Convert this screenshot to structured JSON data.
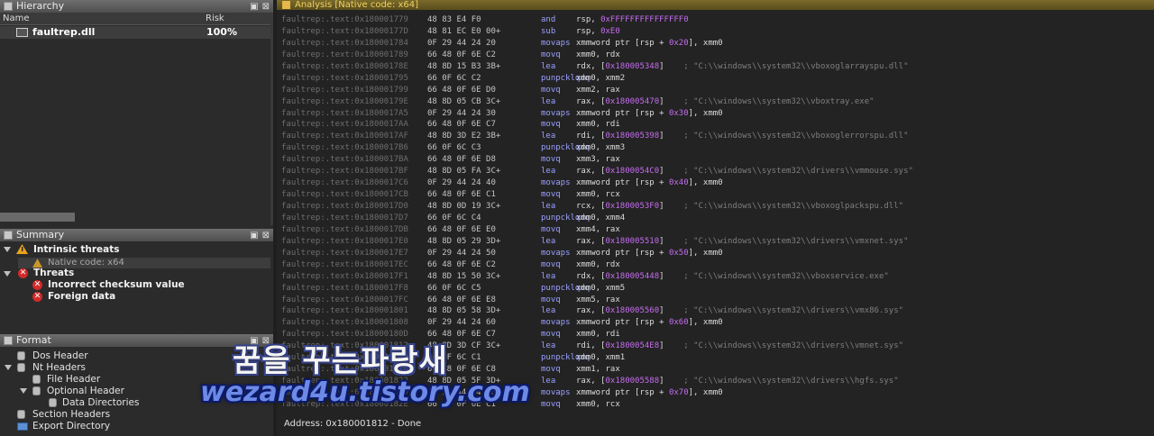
{
  "hierarchy": {
    "title": "Hierarchy",
    "col_name": "Name",
    "col_risk": "Risk",
    "row": {
      "name": "faultrep.dll",
      "risk": "100%"
    }
  },
  "summary": {
    "title": "Summary",
    "intrinsic": "Intrinsic threats",
    "native": "Native code: x64",
    "threats": "Threats",
    "items": [
      "Incorrect checksum value",
      "Foreign data"
    ]
  },
  "format": {
    "title": "Format",
    "items": [
      {
        "label": "Dos Header",
        "icon": "database-icon"
      },
      {
        "label": "Nt Headers",
        "icon": "database-icon"
      },
      {
        "label": "File Header",
        "icon": "database-icon"
      },
      {
        "label": "Optional Header",
        "icon": "database-icon"
      },
      {
        "label": "Data Directories",
        "icon": "database-icon"
      },
      {
        "label": "Section Headers",
        "icon": "database-icon"
      },
      {
        "label": "Export Directory",
        "icon": "folder-icon"
      }
    ]
  },
  "analysis": {
    "title": "Analysis [Native code: x64]",
    "status": "Address: 0x180001812 - Done",
    "lines": [
      {
        "addr": "faultrep:.text:0x180001779",
        "bytes": "48 83 E4 F0",
        "mn": "and",
        "op": "rsp, ",
        "imm": "0xFFFFFFFFFFFFFFF0",
        "op2": "",
        "cm": ""
      },
      {
        "addr": "faultrep:.text:0x18000177D",
        "bytes": "48 81 EC E0 00+",
        "mn": "sub",
        "op": "rsp, ",
        "imm": "0xE0",
        "op2": "",
        "cm": ""
      },
      {
        "addr": "faultrep:.text:0x180001784",
        "bytes": "0F 29 44 24 20",
        "mn": "movaps",
        "op": "xmmword ptr [rsp + ",
        "imm": "0x20",
        "op2": "], xmm0",
        "cm": ""
      },
      {
        "addr": "faultrep:.text:0x180001789",
        "bytes": "66 48 0F 6E C2",
        "mn": "movq",
        "op": "xmm0, rdx",
        "imm": "",
        "op2": "",
        "cm": ""
      },
      {
        "addr": "faultrep:.text:0x18000178E",
        "bytes": "48 8D 15 B3 3B+",
        "mn": "lea",
        "op": "rdx, [",
        "imm": "0x180005348",
        "op2": "]",
        "cm": "; \"C:\\\\windows\\\\system32\\\\vboxoglarrayspu.dll\""
      },
      {
        "addr": "faultrep:.text:0x180001795",
        "bytes": "66 0F 6C C2",
        "mn": "punpcklqdq",
        "op": "xmm0, xmm2",
        "imm": "",
        "op2": "",
        "cm": ""
      },
      {
        "addr": "faultrep:.text:0x180001799",
        "bytes": "66 48 0F 6E D0",
        "mn": "movq",
        "op": "xmm2, rax",
        "imm": "",
        "op2": "",
        "cm": ""
      },
      {
        "addr": "faultrep:.text:0x18000179E",
        "bytes": "48 8D 05 CB 3C+",
        "mn": "lea",
        "op": "rax, [",
        "imm": "0x180005470",
        "op2": "]",
        "cm": "; \"C:\\\\windows\\\\system32\\\\vboxtray.exe\""
      },
      {
        "addr": "faultrep:.text:0x1800017A5",
        "bytes": "0F 29 44 24 30",
        "mn": "movaps",
        "op": "xmmword ptr [rsp + ",
        "imm": "0x30",
        "op2": "], xmm0",
        "cm": ""
      },
      {
        "addr": "faultrep:.text:0x1800017AA",
        "bytes": "66 48 0F 6E C7",
        "mn": "movq",
        "op": "xmm0, rdi",
        "imm": "",
        "op2": "",
        "cm": ""
      },
      {
        "addr": "faultrep:.text:0x1800017AF",
        "bytes": "48 8D 3D E2 3B+",
        "mn": "lea",
        "op": "rdi, [",
        "imm": "0x180005398",
        "op2": "]",
        "cm": "; \"C:\\\\windows\\\\system32\\\\vboxoglerrorspu.dll\""
      },
      {
        "addr": "faultrep:.text:0x1800017B6",
        "bytes": "66 0F 6C C3",
        "mn": "punpcklqdq",
        "op": "xmm0, xmm3",
        "imm": "",
        "op2": "",
        "cm": ""
      },
      {
        "addr": "faultrep:.text:0x1800017BA",
        "bytes": "66 48 0F 6E D8",
        "mn": "movq",
        "op": "xmm3, rax",
        "imm": "",
        "op2": "",
        "cm": ""
      },
      {
        "addr": "faultrep:.text:0x1800017BF",
        "bytes": "48 8D 05 FA 3C+",
        "mn": "lea",
        "op": "rax, [",
        "imm": "0x1800054C0",
        "op2": "]",
        "cm": "; \"C:\\\\windows\\\\system32\\\\drivers\\\\vmmouse.sys\""
      },
      {
        "addr": "faultrep:.text:0x1800017C6",
        "bytes": "0F 29 44 24 40",
        "mn": "movaps",
        "op": "xmmword ptr [rsp + ",
        "imm": "0x40",
        "op2": "], xmm0",
        "cm": ""
      },
      {
        "addr": "faultrep:.text:0x1800017CB",
        "bytes": "66 48 0F 6E C1",
        "mn": "movq",
        "op": "xmm0, rcx",
        "imm": "",
        "op2": "",
        "cm": ""
      },
      {
        "addr": "faultrep:.text:0x1800017D0",
        "bytes": "48 8D 0D 19 3C+",
        "mn": "lea",
        "op": "rcx, [",
        "imm": "0x1800053F0",
        "op2": "]",
        "cm": "; \"C:\\\\windows\\\\system32\\\\vboxoglpackspu.dll\""
      },
      {
        "addr": "faultrep:.text:0x1800017D7",
        "bytes": "66 0F 6C C4",
        "mn": "punpcklqdq",
        "op": "xmm0, xmm4",
        "imm": "",
        "op2": "",
        "cm": ""
      },
      {
        "addr": "faultrep:.text:0x1800017DB",
        "bytes": "66 48 0F 6E E0",
        "mn": "movq",
        "op": "xmm4, rax",
        "imm": "",
        "op2": "",
        "cm": ""
      },
      {
        "addr": "faultrep:.text:0x1800017E0",
        "bytes": "48 8D 05 29 3D+",
        "mn": "lea",
        "op": "rax, [",
        "imm": "0x180005510",
        "op2": "]",
        "cm": "; \"C:\\\\windows\\\\system32\\\\drivers\\\\vmxnet.sys\""
      },
      {
        "addr": "faultrep:.text:0x1800017E7",
        "bytes": "0F 29 44 24 50",
        "mn": "movaps",
        "op": "xmmword ptr [rsp + ",
        "imm": "0x50",
        "op2": "], xmm0",
        "cm": ""
      },
      {
        "addr": "faultrep:.text:0x1800017EC",
        "bytes": "66 48 0F 6E C2",
        "mn": "movq",
        "op": "xmm0, rdx",
        "imm": "",
        "op2": "",
        "cm": ""
      },
      {
        "addr": "faultrep:.text:0x1800017F1",
        "bytes": "48 8D 15 50 3C+",
        "mn": "lea",
        "op": "rdx, [",
        "imm": "0x180005448",
        "op2": "]",
        "cm": "; \"C:\\\\windows\\\\system32\\\\vboxservice.exe\""
      },
      {
        "addr": "faultrep:.text:0x1800017F8",
        "bytes": "66 0F 6C C5",
        "mn": "punpcklqdq",
        "op": "xmm0, xmm5",
        "imm": "",
        "op2": "",
        "cm": ""
      },
      {
        "addr": "faultrep:.text:0x1800017FC",
        "bytes": "66 48 0F 6E E8",
        "mn": "movq",
        "op": "xmm5, rax",
        "imm": "",
        "op2": "",
        "cm": ""
      },
      {
        "addr": "faultrep:.text:0x180001801",
        "bytes": "48 8D 05 58 3D+",
        "mn": "lea",
        "op": "rax, [",
        "imm": "0x180005560",
        "op2": "]",
        "cm": "; \"C:\\\\windows\\\\system32\\\\drivers\\\\vmx86.sys\""
      },
      {
        "addr": "faultrep:.text:0x180001808",
        "bytes": "0F 29 44 24 60",
        "mn": "movaps",
        "op": "xmmword ptr [rsp + ",
        "imm": "0x60",
        "op2": "], xmm0",
        "cm": ""
      },
      {
        "addr": "faultrep:.text:0x18000180D",
        "bytes": "66 48 0F 6E C7",
        "mn": "movq",
        "op": "xmm0, rdi",
        "imm": "",
        "op2": "",
        "cm": ""
      },
      {
        "addr": "faultrep:.text:0x180001812",
        "bytes": "48 8D 3D CF 3C+",
        "mn": "lea",
        "op": "rdi, [",
        "imm": "0x1800054E8",
        "op2": "]",
        "cm": "; \"C:\\\\windows\\\\system32\\\\drivers\\\\vmnet.sys\""
      },
      {
        "addr": "faultrep:.text:0x180001819",
        "bytes": "66 0F 6C C1",
        "mn": "punpcklqdq",
        "op": "xmm0, xmm1",
        "imm": "",
        "op2": "",
        "cm": ""
      },
      {
        "addr": "faultrep:.text:0x18000181D",
        "bytes": "66 48 0F 6E C8",
        "mn": "movq",
        "op": "xmm1, rax",
        "imm": "",
        "op2": "",
        "cm": ""
      },
      {
        "addr": "faultrep:.text:0x180001822",
        "bytes": "48 8D 05 5F 3D+",
        "mn": "lea",
        "op": "rax, [",
        "imm": "0x180005588",
        "op2": "]",
        "cm": "; \"C:\\\\windows\\\\system32\\\\drivers\\\\hgfs.sys\""
      },
      {
        "addr": "faultrep:.text:0x180001829",
        "bytes": "0F 29 44 24 70",
        "mn": "movaps",
        "op": "xmmword ptr [rsp + ",
        "imm": "0x70",
        "op2": "], xmm0",
        "cm": ""
      },
      {
        "addr": "faultrep:.text:0x18000182E",
        "bytes": "66 48 0F 6E C1",
        "mn": "movq",
        "op": "xmm0, rcx",
        "imm": "",
        "op2": "",
        "cm": ""
      }
    ]
  },
  "watermark": {
    "line1": "꿈을 꾸는파랑새",
    "line2": "wezard4u.tistory.com"
  }
}
